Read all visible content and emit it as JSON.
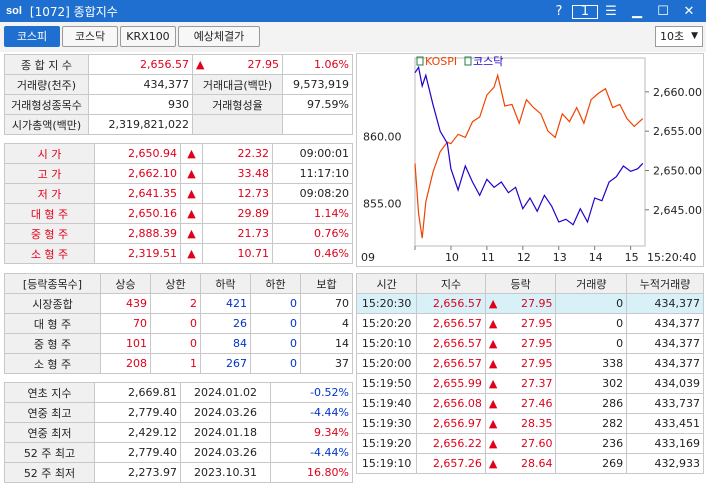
{
  "window": {
    "logo": "sol",
    "title": "[1072] 종합지수",
    "help": "?",
    "pin": "1"
  },
  "toolbar": {
    "tabs": [
      "코스피",
      "코스닥",
      "KRX100",
      "예상체결가"
    ],
    "interval": "10초"
  },
  "summary": {
    "r1": {
      "label": "종 합 지 수",
      "value": "2,656.57",
      "arrow": "▲",
      "change": "27.95",
      "pct": "1.06%"
    },
    "r2": {
      "label": "거래량(천주)",
      "value": "434,377",
      "label2": "거래대금(백만)",
      "value2": "9,573,919"
    },
    "r3": {
      "label": "거래형성종목수",
      "value": "930",
      "label2": "거래형성율",
      "value2": "97.59%"
    },
    "r4": {
      "label": "시가총액(백만)",
      "value": "2,319,821,022"
    }
  },
  "prices": [
    {
      "label": "시      가",
      "value": "2,650.94",
      "arrow": "▲",
      "change": "22.32",
      "extra": "09:00:01",
      "extra_red": false
    },
    {
      "label": "고      가",
      "value": "2,662.10",
      "arrow": "▲",
      "change": "33.48",
      "extra": "11:17:10",
      "extra_red": false
    },
    {
      "label": "저      가",
      "value": "2,641.35",
      "arrow": "▲",
      "change": "12.73",
      "extra": "09:08:20",
      "extra_red": false
    },
    {
      "label": "대 형 주",
      "value": "2,650.16",
      "arrow": "▲",
      "change": "29.89",
      "extra": "1.14%",
      "extra_red": true
    },
    {
      "label": "중 형 주",
      "value": "2,888.39",
      "arrow": "▲",
      "change": "21.73",
      "extra": "0.76%",
      "extra_red": true
    },
    {
      "label": "소 형 주",
      "value": "2,319.51",
      "arrow": "▲",
      "change": "10.71",
      "extra": "0.46%",
      "extra_red": true
    }
  ],
  "breadth": {
    "headers": [
      "[등락종목수]",
      "상승",
      "상한",
      "하락",
      "하한",
      "보합"
    ],
    "rows": [
      {
        "label": "시장종합",
        "up": "439",
        "uplim": "2",
        "down": "421",
        "downlim": "0",
        "flat": "70"
      },
      {
        "label": "대 형 주",
        "up": "70",
        "uplim": "0",
        "down": "26",
        "downlim": "0",
        "flat": "4"
      },
      {
        "label": "중 형 주",
        "up": "101",
        "uplim": "0",
        "down": "84",
        "downlim": "0",
        "flat": "14"
      },
      {
        "label": "소 형 주",
        "up": "208",
        "uplim": "1",
        "down": "267",
        "downlim": "0",
        "flat": "37"
      }
    ]
  },
  "yearly": [
    {
      "label": "연초  지수",
      "value": "2,669.81",
      "date": "2024.01.02",
      "pct": "-0.52%",
      "dir": "down"
    },
    {
      "label": "연중  최고",
      "value": "2,779.40",
      "date": "2024.03.26",
      "pct": "-4.44%",
      "dir": "down"
    },
    {
      "label": "연중  최저",
      "value": "2,429.12",
      "date": "2024.01.18",
      "pct": "9.34%",
      "dir": "up"
    },
    {
      "label": "52 주 최고",
      "value": "2,779.40",
      "date": "2024.03.26",
      "pct": "-4.44%",
      "dir": "down"
    },
    {
      "label": "52 주 최저",
      "value": "2,273.97",
      "date": "2023.10.31",
      "pct": "16.80%",
      "dir": "up"
    }
  ],
  "ticks": {
    "headers": [
      "시간",
      "지수",
      "등락",
      "거래량",
      "누적거래량"
    ],
    "rows": [
      {
        "time": "15:20:30",
        "index": "2,656.57",
        "arrow": "▲",
        "change": "27.95",
        "vol": "0",
        "cum": "434,377"
      },
      {
        "time": "15:20:20",
        "index": "2,656.57",
        "arrow": "▲",
        "change": "27.95",
        "vol": "0",
        "cum": "434,377"
      },
      {
        "time": "15:20:10",
        "index": "2,656.57",
        "arrow": "▲",
        "change": "27.95",
        "vol": "0",
        "cum": "434,377"
      },
      {
        "time": "15:20:00",
        "index": "2,656.57",
        "arrow": "▲",
        "change": "27.95",
        "vol": "338",
        "cum": "434,377"
      },
      {
        "time": "15:19:50",
        "index": "2,655.99",
        "arrow": "▲",
        "change": "27.37",
        "vol": "302",
        "cum": "434,039"
      },
      {
        "time": "15:19:40",
        "index": "2,656.08",
        "arrow": "▲",
        "change": "27.46",
        "vol": "286",
        "cum": "433,737"
      },
      {
        "time": "15:19:30",
        "index": "2,656.97",
        "arrow": "▲",
        "change": "28.35",
        "vol": "282",
        "cum": "433,451"
      },
      {
        "time": "15:19:20",
        "index": "2,656.22",
        "arrow": "▲",
        "change": "27.60",
        "vol": "236",
        "cum": "433,169"
      },
      {
        "time": "15:19:10",
        "index": "2,657.26",
        "arrow": "▲",
        "change": "28.64",
        "vol": "269",
        "cum": "432,933"
      }
    ]
  },
  "chart_data": {
    "type": "line",
    "legend": [
      "KOSPI",
      "코스닥"
    ],
    "colors": {
      "kospi": "#ee4400",
      "kosdaq": "#2200cc"
    },
    "x_ticks": [
      "09",
      "10",
      "11",
      "12",
      "13",
      "14",
      "15"
    ],
    "x_end_label": "15:20:40",
    "y_left_ticks": [
      "860.00",
      "855.00"
    ],
    "y_right_ticks": [
      "2,660.00",
      "2,655.00",
      "2,650.00",
      "2,645.00"
    ],
    "y_left_range": [
      851.8,
      865.9
    ],
    "y_right_range": [
      2640.4,
      2664.3
    ],
    "series": [
      {
        "name": "KOSPI",
        "axis": "right",
        "x": [
          9.0,
          9.1,
          9.2,
          9.3,
          9.5,
          9.7,
          9.9,
          10.0,
          10.2,
          10.4,
          10.6,
          10.8,
          11.0,
          11.2,
          11.3,
          11.5,
          11.7,
          11.9,
          12.1,
          12.3,
          12.5,
          12.7,
          12.9,
          13.1,
          13.3,
          13.5,
          13.7,
          13.9,
          14.1,
          14.3,
          14.5,
          14.7,
          14.9,
          15.1,
          15.34
        ],
        "y": [
          2650.9,
          2644.5,
          2641.4,
          2646.0,
          2649.8,
          2652.4,
          2653.6,
          2653.4,
          2654.6,
          2654.2,
          2656.2,
          2656.8,
          2659.6,
          2660.6,
          2662.1,
          2658.2,
          2658.4,
          2656.0,
          2659.0,
          2658.0,
          2657.2,
          2655.0,
          2654.2,
          2657.2,
          2656.2,
          2658.0,
          2656.0,
          2659.0,
          2659.8,
          2660.4,
          2658.0,
          2658.4,
          2656.6,
          2655.6,
          2656.6
        ]
      },
      {
        "name": "코스닥",
        "axis": "left",
        "x": [
          9.0,
          9.1,
          9.2,
          9.3,
          9.5,
          9.7,
          9.9,
          10.0,
          10.2,
          10.4,
          10.6,
          10.8,
          11.0,
          11.2,
          11.4,
          11.6,
          11.8,
          12.0,
          12.2,
          12.4,
          12.6,
          12.8,
          13.0,
          13.2,
          13.4,
          13.6,
          13.8,
          14.0,
          14.2,
          14.4,
          14.6,
          14.8,
          15.0,
          15.2,
          15.34
        ],
        "y": [
          864.8,
          865.2,
          863.8,
          864.6,
          862.4,
          860.4,
          859.5,
          857.6,
          856.0,
          857.8,
          856.6,
          855.6,
          856.8,
          856.2,
          856.6,
          855.8,
          856.2,
          854.6,
          855.4,
          854.4,
          855.6,
          854.8,
          853.6,
          853.8,
          853.4,
          854.6,
          853.6,
          855.4,
          855.2,
          856.6,
          857.0,
          857.8,
          857.4,
          857.6,
          858.0
        ]
      }
    ]
  }
}
